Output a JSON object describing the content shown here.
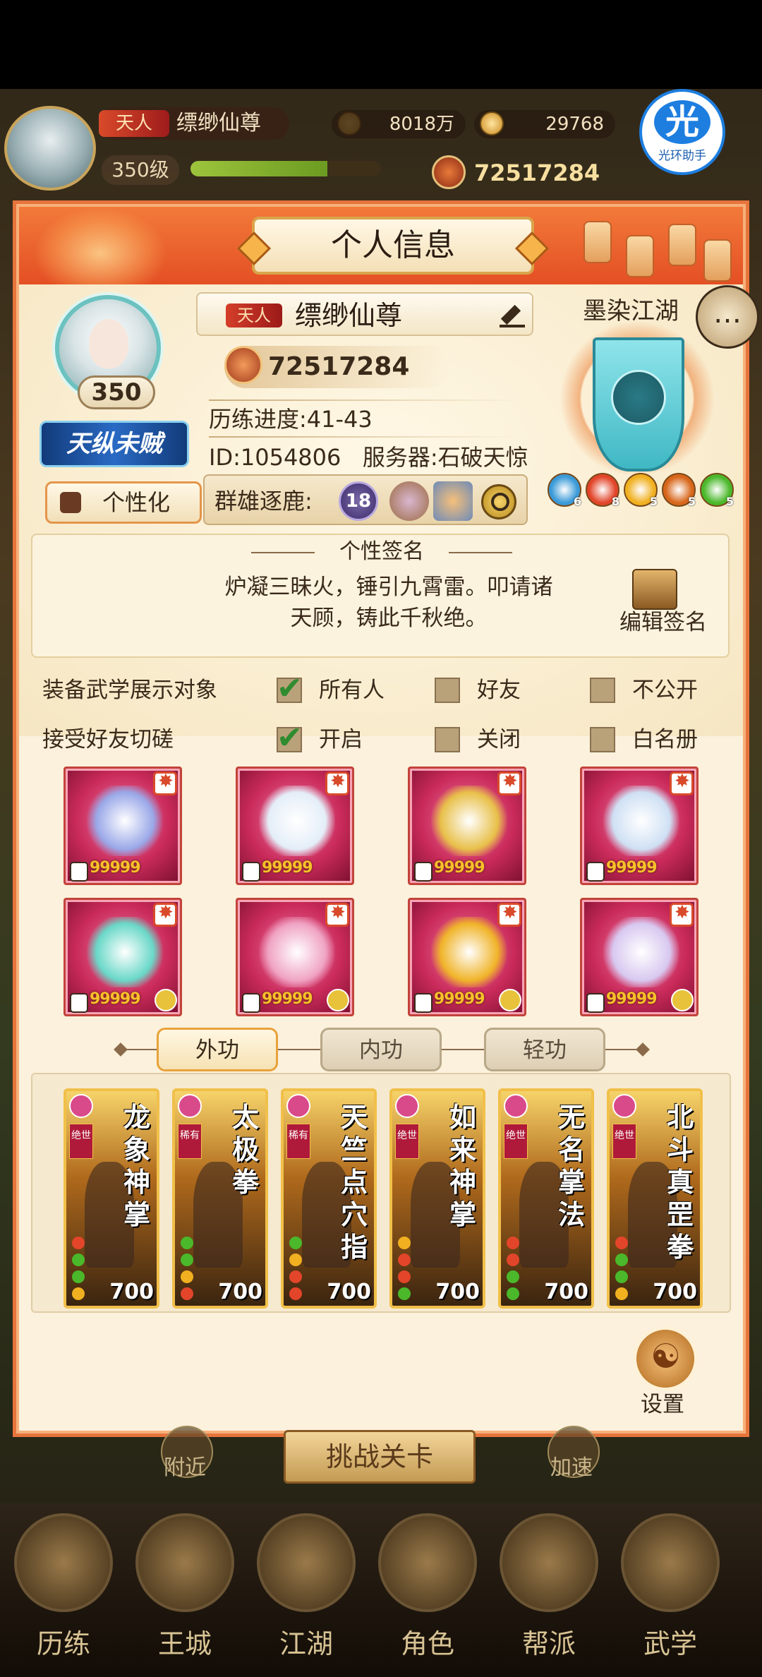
{
  "topbar": {
    "rank_badge": "天人",
    "player_name": "缥缈仙尊",
    "level": "350级",
    "xp_fraction": 0.72,
    "coins": "8018万",
    "ingots": "29768",
    "power": "72517284",
    "helper_glyph": "光",
    "helper_label": "光环助手"
  },
  "panel": {
    "title": "个人信息",
    "portrait_level": "350",
    "title_badge": "天纵未贼",
    "personalize_label": "个性化",
    "rank_badge": "天人",
    "name": "缥缈仙尊",
    "power": "72517284",
    "progress": "历练进度:41-43",
    "id_server": "ID:1054806   服务器:石破天惊",
    "qunxiong_label": "群雄逐鹿:",
    "qunxiong_rank": "18",
    "sect_name": "墨染江湖",
    "gems": [
      {
        "color": "#3a9ad8",
        "count": "6"
      },
      {
        "color": "#e2452a",
        "count": "8"
      },
      {
        "color": "#f0b020",
        "count": "5"
      },
      {
        "color": "#d8661a",
        "count": "5"
      },
      {
        "color": "#4ab82a",
        "count": "5"
      }
    ]
  },
  "signature": {
    "title": "个性签名",
    "line1": "炉凝三昧火，锤引九霄雷。叩请诸",
    "line2": "天顾，铸此千秋绝。",
    "edit_label": "编辑签名"
  },
  "options": {
    "display_label": "装备武学展示对象",
    "display_choices": [
      "所有人",
      "好友",
      "不公开"
    ],
    "display_selected": 0,
    "spar_label": "接受好友切磋",
    "spar_choices": [
      "开启",
      "关闭",
      "白名册"
    ],
    "spar_selected": 0
  },
  "equipment": [
    {
      "name": "gauntlet",
      "level": "99999",
      "color": "#9aa8e8"
    },
    {
      "name": "robe",
      "level": "99999",
      "color": "#e4eef8"
    },
    {
      "name": "belt",
      "level": "99999",
      "color": "#e8c04a"
    },
    {
      "name": "boots",
      "level": "99999",
      "color": "#cfe0f4"
    },
    {
      "name": "necklace",
      "level": "99999",
      "color": "#6ad8c8"
    },
    {
      "name": "lotus-staff",
      "level": "99999",
      "color": "#f0a4c4"
    },
    {
      "name": "gold-ring",
      "level": "99999",
      "color": "#f0b42a"
    },
    {
      "name": "silver-ring",
      "level": "99999",
      "color": "#d8c8f0"
    }
  ],
  "tabs": [
    "外功",
    "内功",
    "轻功"
  ],
  "active_tab": 0,
  "skills": [
    {
      "name": "龙象神掌",
      "grade": "绝世",
      "value": "700"
    },
    {
      "name": "太极拳",
      "grade": "稀有",
      "value": "700"
    },
    {
      "name": "天竺点穴指",
      "grade": "稀有",
      "value": "700"
    },
    {
      "name": "如来神掌",
      "grade": "绝世",
      "value": "700"
    },
    {
      "name": "无名掌法",
      "grade": "绝世",
      "value": "700"
    },
    {
      "name": "北斗真罡拳",
      "grade": "绝世",
      "value": "700"
    }
  ],
  "settings_label": "设置",
  "under_layer": {
    "challenge_label": "挑战关卡",
    "nearby_label": "附近",
    "speedup_label": "加速"
  },
  "bottom_nav": [
    "历练",
    "王城",
    "江湖",
    "角色",
    "帮派",
    "武学"
  ]
}
